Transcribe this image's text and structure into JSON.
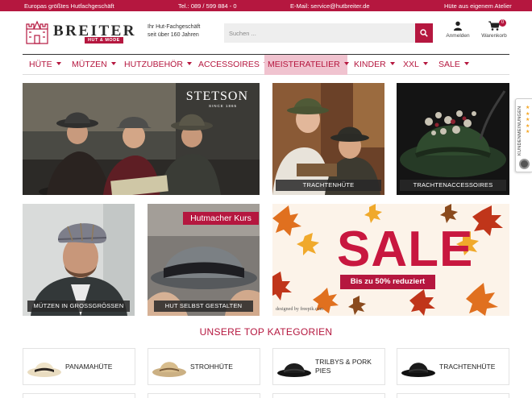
{
  "topbar": {
    "slogan": "Europas größtes Hutfachgeschäft",
    "phone": "Tel.: 089 / 599 884 - 0",
    "email": "E-Mail: service@hutbreiter.de",
    "atelier": "Hüte aus eigenem Atelier"
  },
  "header": {
    "brand": "BREITER",
    "subbrand": "HUT & MODE",
    "tagline_1": "Ihr Hut-Fachgeschäft",
    "tagline_2": "seit über 160 Jahren",
    "search_placeholder": "Suchen ...",
    "account_label": "Anmelden",
    "cart_label": "Warenkorb",
    "cart_count": "0"
  },
  "nav": {
    "items": [
      {
        "label": "HÜTE"
      },
      {
        "label": "MÜTZEN"
      },
      {
        "label": "HUTZUBEHÖR"
      },
      {
        "label": "ACCESSOIRES"
      },
      {
        "label": "MEISTERATELIER"
      },
      {
        "label": "KINDER"
      },
      {
        "label": "XXL"
      },
      {
        "label": "SALE"
      }
    ],
    "active": "MEISTERATELIER"
  },
  "tiles": {
    "hero": {
      "brand": "STETSON",
      "brand_sub": "SINCE 1865"
    },
    "trachtenhuete": "TRACHTENHÜTE",
    "trachtenaccessoires": "TRACHTENACCESSOIRES",
    "muetzen": "MÜTZEN IN GROSSGRÖSSEN",
    "kurs_badge": "Hutmacher Kurs",
    "hut_gestalten": "HUT SELBST GESTALTEN",
    "sale": {
      "word": "SALE",
      "sub": "Bis zu 50% reduziert",
      "credit": "designed by freepik.com"
    }
  },
  "section_title": "UNSERE TOP KATEGORIEN",
  "categories": [
    {
      "label": "PANAMAHÜTE"
    },
    {
      "label": "STROHHÜTE"
    },
    {
      "label": "TRILBYS & PORK PIES"
    },
    {
      "label": "TRACHTENHÜTE"
    }
  ],
  "side_tab": {
    "label": "KUNDENMEINUNGEN"
  },
  "colors": {
    "accent": "#b5173f",
    "nav_active_bg": "#f0c3cf"
  }
}
